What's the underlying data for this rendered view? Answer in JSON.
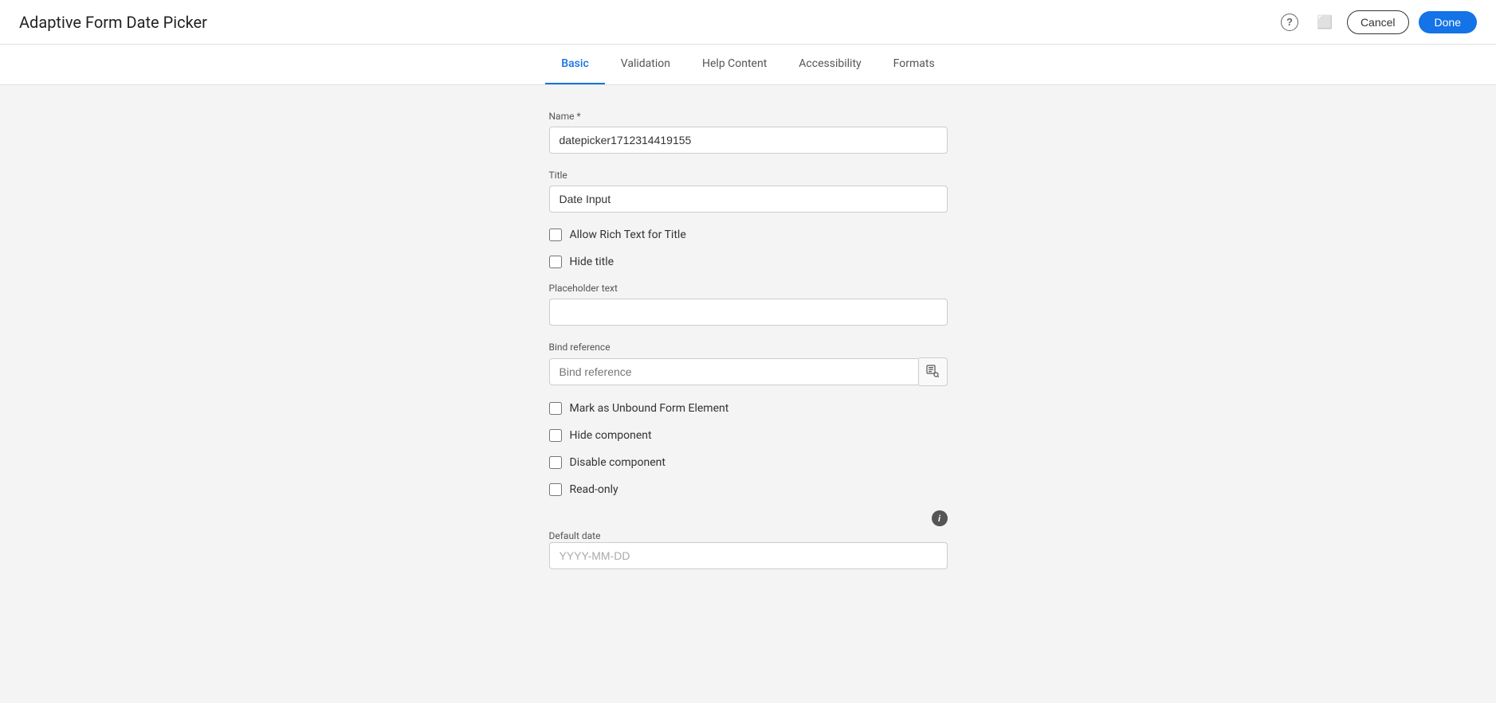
{
  "header": {
    "title": "Adaptive Form Date Picker",
    "cancel_label": "Cancel",
    "done_label": "Done"
  },
  "tabs": [
    {
      "id": "basic",
      "label": "Basic",
      "active": true
    },
    {
      "id": "validation",
      "label": "Validation",
      "active": false
    },
    {
      "id": "help-content",
      "label": "Help Content",
      "active": false
    },
    {
      "id": "accessibility",
      "label": "Accessibility",
      "active": false
    },
    {
      "id": "formats",
      "label": "Formats",
      "active": false
    }
  ],
  "form": {
    "name_label": "Name *",
    "name_value": "datepicker1712314419155",
    "title_label": "Title",
    "title_value": "Date Input",
    "allow_rich_text_label": "Allow Rich Text for Title",
    "allow_rich_text_checked": false,
    "hide_title_label": "Hide title",
    "hide_title_checked": false,
    "placeholder_label": "Placeholder text",
    "placeholder_value": "",
    "bind_reference_label": "Bind reference",
    "bind_reference_placeholder": "Bind reference",
    "bind_reference_value": "",
    "mark_unbound_label": "Mark as Unbound Form Element",
    "mark_unbound_checked": false,
    "hide_component_label": "Hide component",
    "hide_component_checked": false,
    "disable_component_label": "Disable component",
    "disable_component_checked": false,
    "read_only_label": "Read-only",
    "read_only_checked": false,
    "default_date_label": "Default date",
    "default_date_placeholder": "YYYY-MM-DD",
    "default_date_value": ""
  },
  "icons": {
    "help": "?",
    "screen": "⬜",
    "search_db": "🔍",
    "info": "i"
  }
}
